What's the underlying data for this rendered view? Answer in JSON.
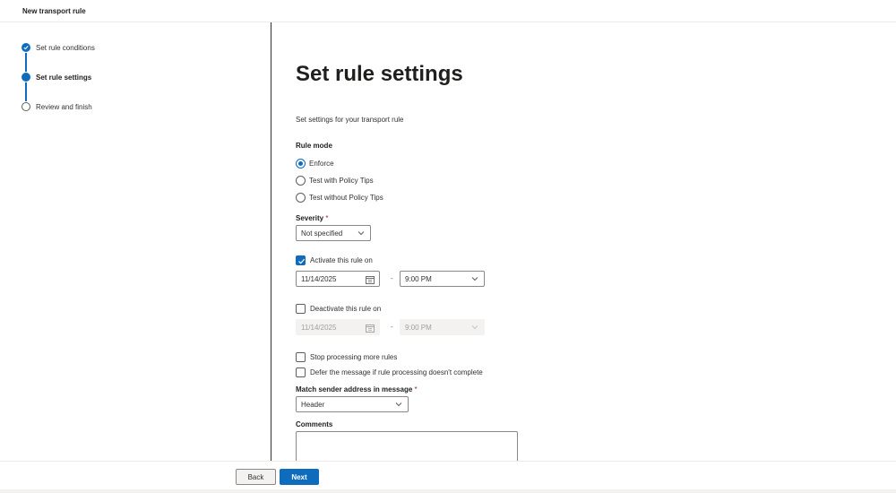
{
  "header": {
    "title": "New transport rule"
  },
  "stepper": {
    "steps": [
      {
        "label": "Set rule conditions",
        "state": "completed"
      },
      {
        "label": "Set rule settings",
        "state": "current"
      },
      {
        "label": "Review and finish",
        "state": "pending"
      }
    ]
  },
  "main": {
    "title": "Set rule settings",
    "subtitle": "Set settings for your transport rule",
    "rule_mode": {
      "label": "Rule mode",
      "options": [
        "Enforce",
        "Test with Policy Tips",
        "Test without Policy Tips"
      ],
      "selected": "Enforce"
    },
    "severity": {
      "label": "Severity",
      "required_mark": "*",
      "value": "Not specified"
    },
    "activate": {
      "label": "Activate this rule on",
      "checked": true,
      "date": "11/14/2025",
      "separator": "-",
      "time": "9:00 PM"
    },
    "deactivate": {
      "label": "Deactivate this rule on",
      "checked": false,
      "date": "11/14/2025",
      "separator": "-",
      "time": "9:00 PM"
    },
    "stop_processing": {
      "label": "Stop processing more rules",
      "checked": false
    },
    "defer": {
      "label": "Defer the message if rule processing doesn't complete",
      "checked": false
    },
    "match_sender": {
      "label": "Match sender address in message",
      "required_mark": "*",
      "value": "Header"
    },
    "comments": {
      "label": "Comments",
      "value": ""
    }
  },
  "footer": {
    "back_label": "Back",
    "next_label": "Next"
  },
  "colors": {
    "accent": "#0f6cbd",
    "text": "#323130",
    "required": "#a4262c"
  }
}
